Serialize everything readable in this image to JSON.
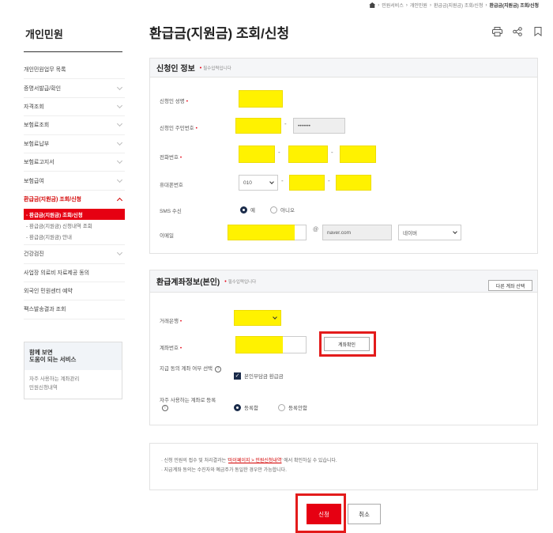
{
  "breadcrumb": [
    "민원서비스",
    "개인민원",
    "환급금(지원금) 조회/신청",
    "환급금(지원금) 조회/신청"
  ],
  "sidebar": {
    "title": "개인민원",
    "items": [
      {
        "label": "개인민원업무 목록"
      },
      {
        "label": "증명서발급/확인"
      },
      {
        "label": "자격조회"
      },
      {
        "label": "보험료조회"
      },
      {
        "label": "보험료납부"
      },
      {
        "label": "보험료고지서"
      },
      {
        "label": "보험급여"
      },
      {
        "label": "환급금(지원금) 조회/신청"
      }
    ],
    "subitems": [
      "- 환급금(지원금) 조회/신청",
      "- 환급금(지원금) 신청내역 조회",
      "- 환급금(지원금) 안내"
    ],
    "items2": [
      {
        "label": "건강검진"
      },
      {
        "label": "사업장 의료비 자료제공 동의"
      },
      {
        "label": "외국인 민원센터 예약"
      },
      {
        "label": "팩스발송결과 조회"
      }
    ],
    "related": {
      "title1": "함께 보면",
      "title2": "도움이 되는 서비스",
      "links": [
        "자주 사용하는 계좌관리",
        "민원신청내역"
      ]
    }
  },
  "header": {
    "title": "환급금(지원금) 조회/신청",
    "icons": [
      "print-icon",
      "share-icon",
      "bookmark-icon"
    ]
  },
  "applicant": {
    "title": "신청인 정보",
    "required_note": "필수입력입니다",
    "name_label": "신청인 성명",
    "rrn_label": "신청인 주민번호",
    "rrn_back": "•••••••",
    "phone_label": "전화번호",
    "mobile_label": "휴대폰번호",
    "mobile_prefix": "010",
    "sms_label": "SMS 수신",
    "sms_yes": "예",
    "sms_no": "아니오",
    "email_label": "이메일",
    "email_at": "@",
    "email_domain": "naver.com",
    "email_select": "네이버"
  },
  "account": {
    "title": "환급계좌정보(본인)",
    "required_note": "필수입력입니다",
    "other_account_btn": "다른 계좌 선택",
    "bank_label": "거래은행",
    "accno_label": "계좌번호",
    "verify_btn": "계좌확인",
    "consent_label": "지급 동의 계좌 여부 선택",
    "consent_check": "본인부담금 환급금",
    "freq_label": "자주 사용하는 계좌로 등록",
    "freq_yes": "등록함",
    "freq_no": "등록안함"
  },
  "notice": {
    "line1_pre": "· 신청 민원의 접수 및 처리결과는 '",
    "line1_link": "마이페이지 > 민원신청내역",
    "line1_post": "' 에서 확인하실 수 있습니다.",
    "line2": "· 지급계좌 동의는 수진자와 예금주가 동일한 경우만 가능합니다."
  },
  "buttons": {
    "apply": "신청",
    "cancel": "취소"
  },
  "colors": {
    "accent": "#e60012",
    "highlight": "#fff200",
    "annotation": "#e31b1b"
  }
}
